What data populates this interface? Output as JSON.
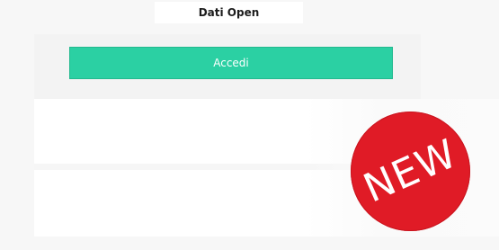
{
  "header": {
    "tab_label": "Dati Open"
  },
  "login": {
    "button_label": "Accedi"
  },
  "badge": {
    "label": "NEW"
  },
  "colors": {
    "accent": "#2bd0a3",
    "badge": "#e01b26",
    "background": "#f7f7f7"
  }
}
